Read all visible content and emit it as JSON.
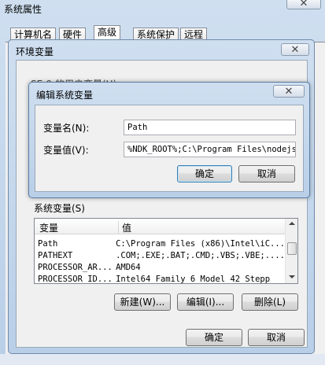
{
  "sysprops": {
    "title": "系统属性",
    "tabs": [
      "计算机名",
      "硬件",
      "高级",
      "系统保护",
      "远程"
    ]
  },
  "envvars": {
    "title": "环境变量",
    "user_section_label": "SE-9 的用户变量(U)",
    "system_section_label": "系统变量(S)",
    "columns": [
      "变量",
      "值"
    ],
    "rows": [
      {
        "name": "Path",
        "value": "C:\\Program Files (x86)\\Intel\\iC..."
      },
      {
        "name": "PATHEXT",
        "value": ".COM;.EXE;.BAT;.CMD;.VBS;.VBE;...."
      },
      {
        "name": "PROCESSOR_AR...",
        "value": "AMD64"
      },
      {
        "name": "PROCESSOR_ID...",
        "value": "Intel64 Family 6 Model 42 Stepp"
      }
    ],
    "new_label": "新建(W)...",
    "edit_label": "编辑(I)...",
    "delete_label": "删除(L)",
    "ok_label": "确定",
    "cancel_label": "取消"
  },
  "editdlg": {
    "title": "编辑系统变量",
    "name_label": "变量名(N):",
    "name_value": "Path",
    "value_label": "变量值(V):",
    "value_value": "%NDK_ROOT%;C:\\Program Files\\nodejs\\",
    "ok_label": "确定",
    "cancel_label": "取消"
  },
  "close_glyph": "✕"
}
